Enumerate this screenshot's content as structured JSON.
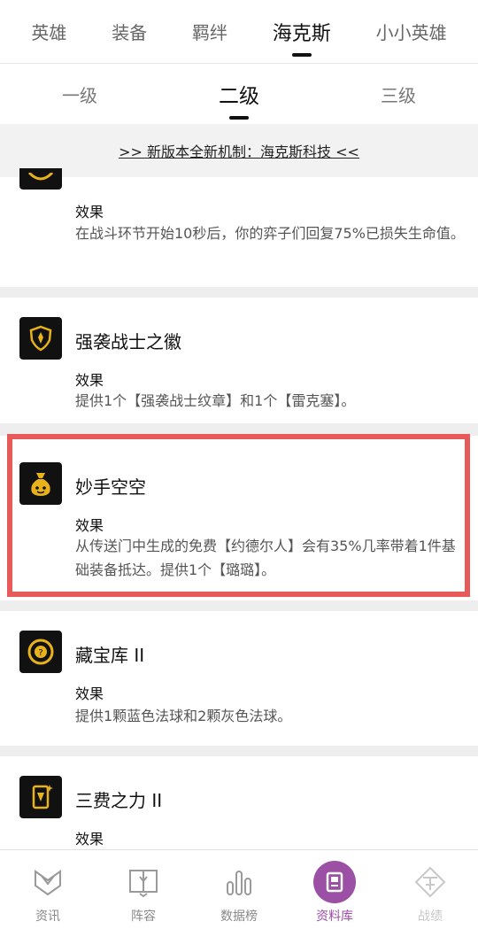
{
  "top_tabs": [
    {
      "label": "英雄"
    },
    {
      "label": "装备"
    },
    {
      "label": "羁绊"
    },
    {
      "label": "海克斯",
      "active": true
    },
    {
      "label": "小小英雄"
    }
  ],
  "level_tabs": [
    {
      "label": "一级"
    },
    {
      "label": "二级",
      "active": true
    },
    {
      "label": "三级"
    }
  ],
  "banner": {
    "text": ">> 新版本全新机制：海克斯科技 <<"
  },
  "cards": [
    {
      "title": "",
      "effect_label": "效果",
      "effect": "在战斗环节开始10秒后，你的弈子们回复75%已损失生命值。",
      "icon": "partial-gold-icon"
    },
    {
      "title": "强袭战士之徽",
      "effect_label": "效果",
      "effect": "提供1个【强袭战士纹章】和1个【雷克塞】。",
      "icon": "shield-emblem-icon"
    },
    {
      "title": "妙手空空",
      "effect_label": "效果",
      "effect": "从传送门中生成的免费【约德尔人】会有35%几率带着1件基础装备抵达。提供1个【璐璐】。",
      "icon": "money-bag-icon"
    },
    {
      "title": "藏宝库 II",
      "effect_label": "效果",
      "effect": "提供1颗蓝色法球和2颗灰色法球。",
      "icon": "treasure-orb-icon"
    },
    {
      "title": "三费之力 II",
      "effect_label": "效果",
      "effect": "",
      "icon": "card-icon"
    }
  ],
  "bottom_nav": [
    {
      "label": "资讯",
      "icon": "news-icon"
    },
    {
      "label": "阵容",
      "icon": "lineup-icon"
    },
    {
      "label": "数据榜",
      "icon": "chart-icon"
    },
    {
      "label": "资料库",
      "icon": "library-icon",
      "active": true
    },
    {
      "label": "战绩",
      "icon": "record-icon"
    }
  ],
  "colors": {
    "accent": "#9b4fa5",
    "highlight": "#e85a5a",
    "icon_gold": "#e8b21a"
  }
}
